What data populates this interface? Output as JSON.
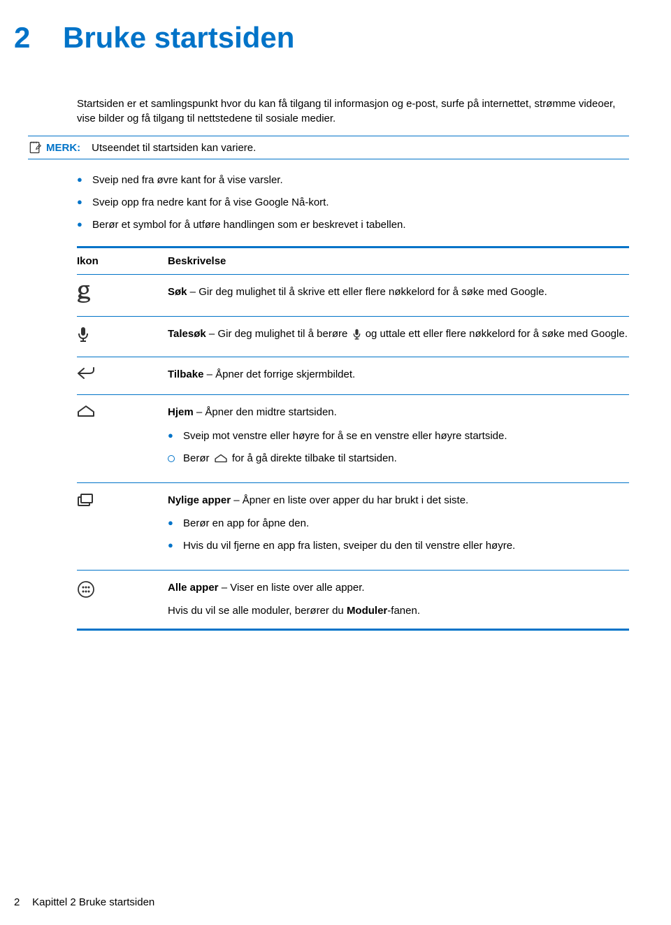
{
  "chapter": {
    "number": "2",
    "title": "Bruke startsiden"
  },
  "intro": "Startsiden er et samlingspunkt hvor du kan få tilgang til informasjon og e-post, surfe på internettet, strømme videoer, vise bilder og få tilgang til nettstedene til sosiale medier.",
  "note": {
    "label": "MERK:",
    "text": "Utseendet til startsiden kan variere."
  },
  "bullets": [
    "Sveip ned fra øvre kant for å vise varsler.",
    "Sveip opp fra nedre kant for å vise Google Nå-kort.",
    "Berør et symbol for å utføre handlingen som er beskrevet i tabellen."
  ],
  "table": {
    "header": {
      "icon": "Ikon",
      "desc": "Beskrivelse"
    },
    "rows": {
      "search": {
        "bold": "Søk",
        "sep": " – ",
        "text": "Gir deg mulighet til å skrive ett eller flere nøkkelord for å søke med Google."
      },
      "voice": {
        "bold": "Talesøk",
        "sep": " – ",
        "pre": "Gir deg mulighet til å berøre ",
        "post": " og uttale ett eller flere nøkkelord for å søke med Google."
      },
      "back": {
        "bold": "Tilbake",
        "sep": " – ",
        "text": "Åpner det forrige skjermbildet."
      },
      "home": {
        "bold": "Hjem",
        "sep": " – ",
        "text": "Åpner den midtre startsiden.",
        "sub1": "Sveip mot venstre eller høyre for å se en venstre eller høyre startside.",
        "sub2a": "Berør ",
        "sub2b": " for å gå direkte tilbake til startsiden."
      },
      "recent": {
        "bold": "Nylige apper",
        "sep": " – ",
        "text": "Åpner en liste over apper du har brukt i det siste.",
        "sub1": "Berør en app for åpne den.",
        "sub2": "Hvis du vil fjerne en app fra listen, sveiper du den til venstre eller høyre."
      },
      "all": {
        "bold": "Alle apper",
        "sep": " – ",
        "text": "Viser en liste over alle apper.",
        "extra_a": "Hvis du vil se alle moduler, berører du ",
        "extra_b": "Moduler",
        "extra_c": "-fanen."
      }
    }
  },
  "footer": {
    "page": "2",
    "text": "Kapittel 2   Bruke startsiden"
  }
}
